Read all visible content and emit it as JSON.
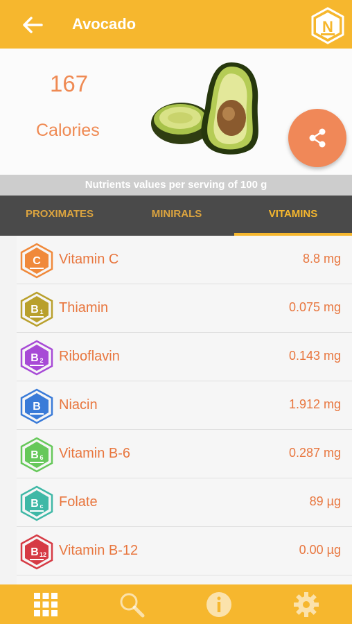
{
  "appbar": {
    "title": "Avocado",
    "logo_text": "N"
  },
  "hero": {
    "calories_value": "167",
    "calories_label": "Calories"
  },
  "serving_text": "Nutrients values per serving of 100 g",
  "tabs": [
    {
      "label": "PROXIMATES"
    },
    {
      "label": "MINIRALS"
    },
    {
      "label": "VITAMINS"
    }
  ],
  "active_tab": "VITAMINS",
  "vitamins": [
    {
      "badge": "C",
      "sub": "",
      "name": "Vitamin C",
      "value": "8.8 mg",
      "color": "#f0893a"
    },
    {
      "badge": "B",
      "sub": "1",
      "name": "Thiamin",
      "value": "0.075 mg",
      "color": "#b9a02c"
    },
    {
      "badge": "B",
      "sub": "2",
      "name": "Riboflavin",
      "value": "0.143 mg",
      "color": "#a74ad6"
    },
    {
      "badge": "B",
      "sub": "",
      "name": "Niacin",
      "value": "1.912 mg",
      "color": "#3a7bd8"
    },
    {
      "badge": "B",
      "sub": "6",
      "name": "Vitamin B-6",
      "value": "0.287 mg",
      "color": "#66c85a"
    },
    {
      "badge": "B",
      "sub": "c",
      "name": "Folate",
      "value": "89 µg",
      "color": "#3fb8a6"
    },
    {
      "badge": "B",
      "sub": "12",
      "name": "Vitamin B-12",
      "value": "0.00 µg",
      "color": "#d63a44"
    }
  ],
  "colors": {
    "accent": "#f6b72e",
    "orange_text": "#e8763e",
    "tab_bg": "#4a4a4a",
    "fab": "#f08858"
  },
  "icons": [
    "back-arrow-icon",
    "app-logo-icon",
    "share-icon",
    "grid-icon",
    "search-icon",
    "info-icon",
    "settings-icon"
  ]
}
